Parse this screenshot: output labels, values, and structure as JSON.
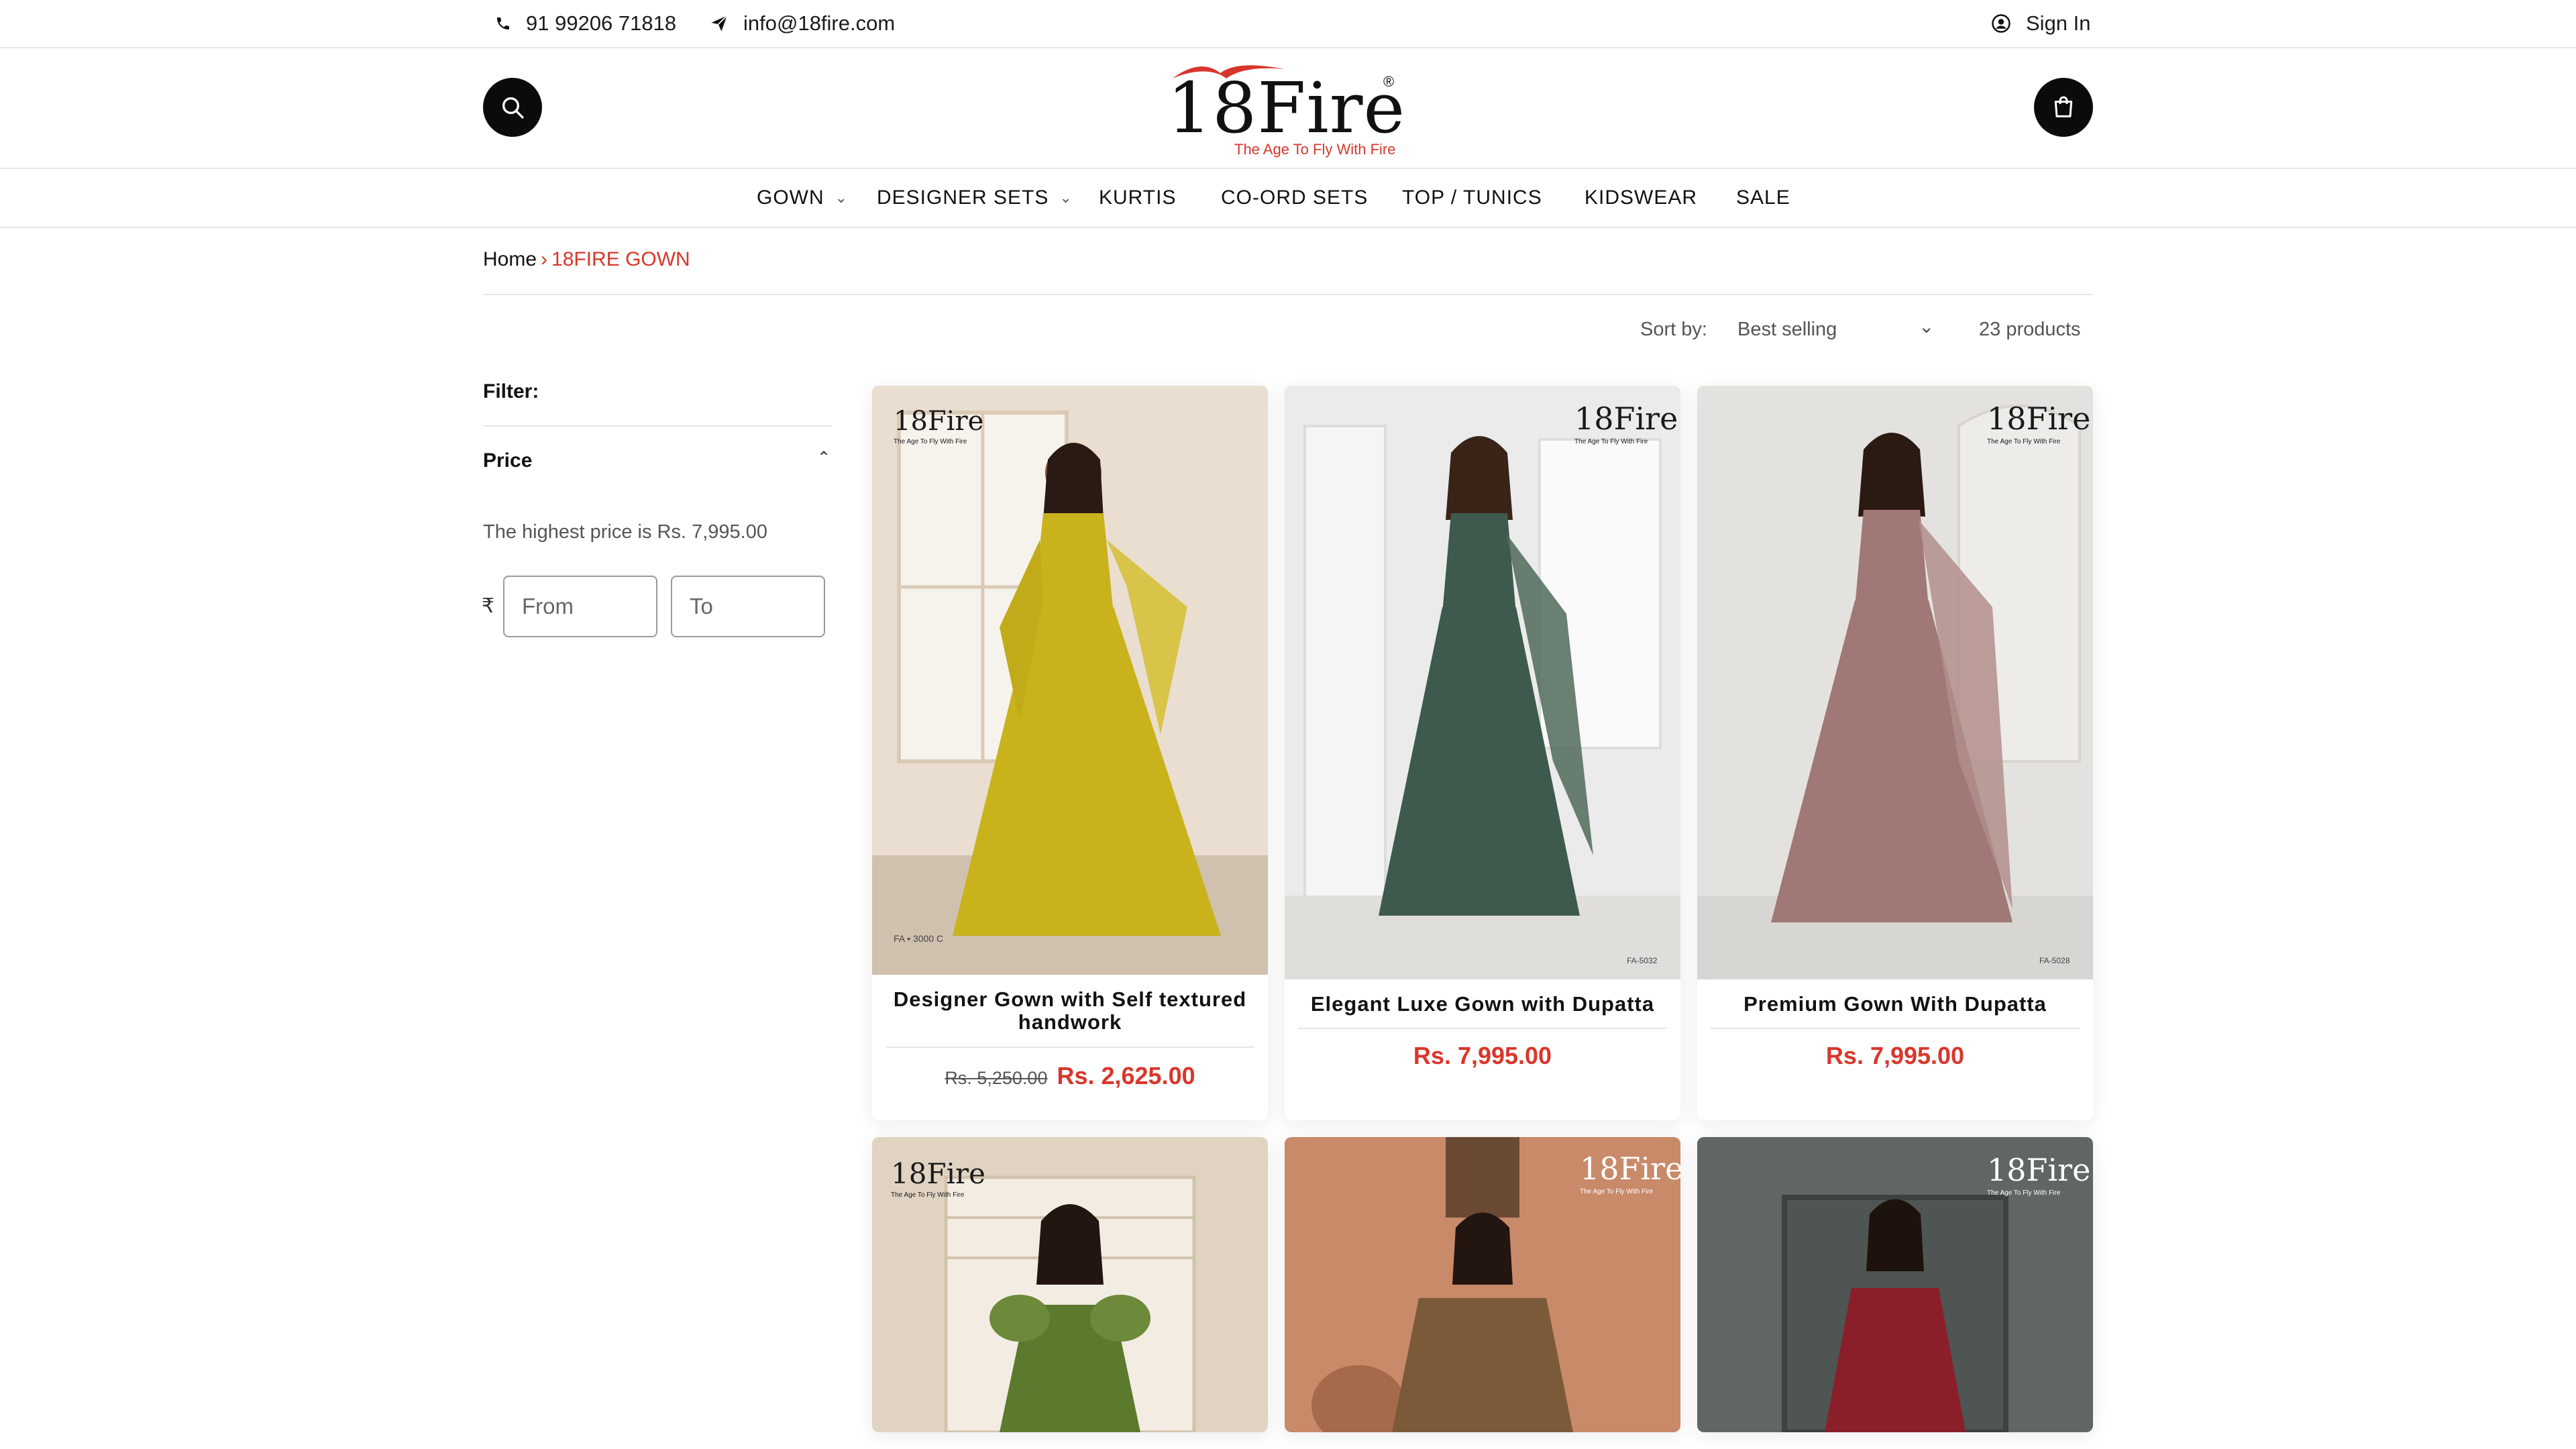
{
  "topbar": {
    "phone": "91 99206 71818",
    "email": "info@18fire.com",
    "sign_in": "Sign In"
  },
  "header": {
    "logo_text": "18Fire",
    "logo_tagline": "The Age To Fly With Fire",
    "logo_reg": "®",
    "search_icon": "search-icon",
    "cart_icon": "cart-icon"
  },
  "nav": {
    "items": [
      {
        "label": "GOWN",
        "has_dropdown": true
      },
      {
        "label": "DESIGNER SETS",
        "has_dropdown": true
      },
      {
        "label": "KURTIS",
        "has_dropdown": false
      },
      {
        "label": "CO-ORD SETS",
        "has_dropdown": false
      },
      {
        "label": "TOP / TUNICS",
        "has_dropdown": false
      },
      {
        "label": "KIDSWEAR",
        "has_dropdown": false
      },
      {
        "label": "SALE",
        "has_dropdown": false
      }
    ]
  },
  "breadcrumb": {
    "home": "Home",
    "separator": "›",
    "current": "18FIRE GOWN"
  },
  "toolbar": {
    "sort_label": "Sort by:",
    "sort_value": "Best selling",
    "product_count": "23 products"
  },
  "filter": {
    "title": "Filter:",
    "price_title": "Price",
    "highest_price_text": "The highest price is Rs. 7,995.00",
    "currency_symbol": "₹",
    "from_placeholder": "From",
    "to_placeholder": "To"
  },
  "products": [
    {
      "brand": "18Fire",
      "brand_tagline": "The Age To Fly With Fire",
      "code": "FA • 3000 C",
      "title": "Designer Gown with Self textured handwork",
      "old_price": "Rs. 5,250.00",
      "price": "Rs. 2,625.00",
      "dress_color": "#c9b21c",
      "bg_color": "#e9ded0"
    },
    {
      "brand": "18Fire",
      "brand_tagline": "The Age To Fly With Fire",
      "code": "FA-5032",
      "title": "Elegant Luxe Gown with Dupatta",
      "old_price": "",
      "price": "Rs. 7,995.00",
      "dress_color": "#3e5a4c",
      "bg_color": "#ebebeb"
    },
    {
      "brand": "18Fire",
      "brand_tagline": "The Age To Fly With Fire",
      "code": "FA-5028",
      "title": "Premium Gown With Dupatta",
      "old_price": "",
      "price": "Rs. 7,995.00",
      "dress_color": "#a07876",
      "bg_color": "#e4e2df"
    },
    {
      "brand": "18Fire",
      "brand_tagline": "The Age To Fly With Fire",
      "dress_color": "#5c7a2e",
      "bg_color": "#e0d3c2"
    },
    {
      "brand": "18Fire",
      "brand_tagline": "The Age To Fly With Fire",
      "dress_color": "#7b5a3a",
      "bg_color": "#c98a6a"
    },
    {
      "brand": "18Fire",
      "brand_tagline": "The Age To Fly With Fire",
      "dress_color": "#8a1f2a",
      "bg_color": "#5f6663"
    }
  ],
  "colors": {
    "accent": "#d9362b",
    "text": "#121212",
    "border": "#e6e6e6"
  }
}
